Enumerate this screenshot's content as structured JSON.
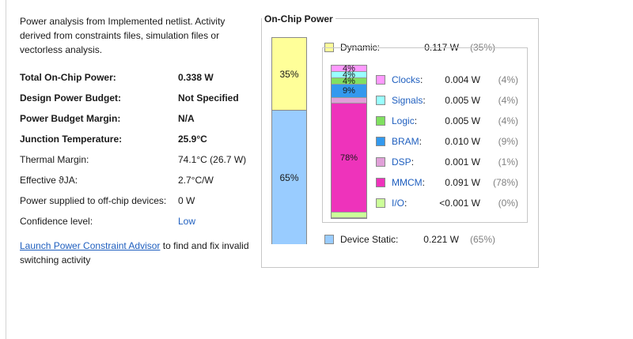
{
  "intro": "Power analysis from Implemented netlist. Activity derived from constraints files, simulation files or vectorless analysis.",
  "summary": [
    {
      "label": "Total On-Chip Power:",
      "value": "0.338 W",
      "bold": true
    },
    {
      "label": "Design Power Budget:",
      "value": "Not Specified",
      "bold": true
    },
    {
      "label": "Power Budget Margin:",
      "value": "N/A",
      "bold": true
    },
    {
      "label": "Junction Temperature:",
      "value": "25.9°C",
      "bold": true
    },
    {
      "label": "Thermal Margin:",
      "value": "74.1°C (26.7 W)",
      "bold": false
    },
    {
      "label": "Effective ϑJA:",
      "value": "2.7°C/W",
      "bold": false
    },
    {
      "label": "Power supplied to off-chip devices:",
      "value": "0 W",
      "bold": false
    },
    {
      "label": "Confidence level:",
      "value": "Low",
      "bold": false,
      "link": true
    }
  ],
  "advisor": {
    "link": "Launch Power Constraint Advisor",
    "text": " to find and fix invalid switching activity"
  },
  "panel": {
    "title": "On-Chip Power",
    "dynamic": {
      "label": "Dynamic:",
      "watts": "0.117 W",
      "pct": "(35%)",
      "share": 0.35,
      "color": "#ffff99"
    },
    "static": {
      "label": "Device Static:",
      "watts": "0.221 W",
      "pct": "(65%)",
      "share": 0.65,
      "color": "#99ccff"
    },
    "bar_labels": {
      "dynamic": "35%",
      "static": "65%"
    },
    "breakdown": [
      {
        "name": "Clocks",
        "watts": "0.004 W",
        "pct": "(4%)",
        "share": 0.04,
        "color": "#ff99ff",
        "bar_label": "4%"
      },
      {
        "name": "Signals",
        "watts": "0.005 W",
        "pct": "(4%)",
        "share": 0.04,
        "color": "#99ffff",
        "bar_label": "4%"
      },
      {
        "name": "Logic",
        "watts": "0.005 W",
        "pct": "(4%)",
        "share": 0.04,
        "color": "#80e060",
        "bar_label": "4%"
      },
      {
        "name": "BRAM",
        "watts": "0.010 W",
        "pct": "(9%)",
        "share": 0.09,
        "color": "#3399ee",
        "bar_label": "9%"
      },
      {
        "name": "DSP",
        "watts": "0.001 W",
        "pct": "(1%)",
        "share": 0.01,
        "color": "#e0a0d8",
        "bar_label": ""
      },
      {
        "name": "MMCM",
        "watts": "0.091 W",
        "pct": "(78%)",
        "share": 0.78,
        "color": "#ee33bb",
        "bar_label": "78%"
      },
      {
        "name": "I/O",
        "watts": "<0.001 W",
        "pct": "(0%)",
        "share": 0.0,
        "color": "#ccff99",
        "bar_label": ""
      }
    ]
  }
}
